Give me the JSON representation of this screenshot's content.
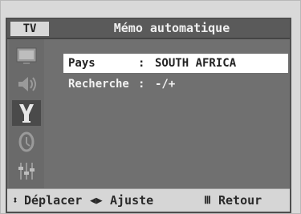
{
  "tab": {
    "label": "TV"
  },
  "header": {
    "title": "Mémo automatique"
  },
  "sidebar": {
    "icons": [
      {
        "name": "picture-icon"
      },
      {
        "name": "sound-icon"
      },
      {
        "name": "channel-antenna-icon",
        "active": true
      },
      {
        "name": "setup-icon"
      },
      {
        "name": "input-icon"
      }
    ]
  },
  "menu": {
    "rows": [
      {
        "label": "Pays",
        "sep": ":",
        "value": "SOUTH AFRICA",
        "selected": true
      },
      {
        "label": "Recherche",
        "sep": ":",
        "value": "-/+",
        "selected": false
      }
    ]
  },
  "footer": {
    "move_glyph": "⬍",
    "move_label": "Déplacer",
    "adjust_glyph": "◀▶",
    "adjust_label": "Ajuste",
    "return_glyph": "Ⅲ",
    "return_label": "Retour"
  },
  "colors": {
    "screen_bg": "#707070",
    "highlight_bg": "#ffffff",
    "footer_bg": "#d6d6d6"
  }
}
